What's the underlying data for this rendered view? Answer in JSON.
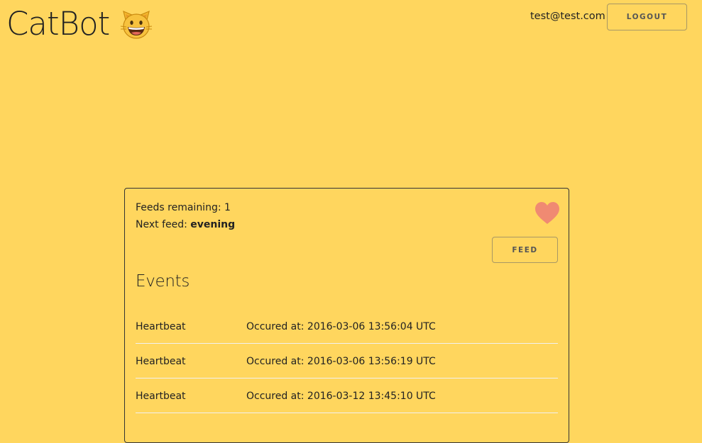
{
  "header": {
    "app_title": "CatBot",
    "logo_icon": "grinning-cat-face-icon",
    "user_email": "test@test.com",
    "logout_label": "LOGOUT"
  },
  "status": {
    "feeds_label": "Feeds remaining:",
    "feeds_remaining": "1",
    "next_feed_label": "Next feed:",
    "next_feed_value": "evening",
    "heart_icon": "heart-icon",
    "heart_color": "#F08A72"
  },
  "actions": {
    "feed_label": "FEED"
  },
  "events": {
    "title": "Events",
    "rows": [
      {
        "type": "Heartbeat",
        "time": "Occured at: 2016-03-06 13:56:04 UTC"
      },
      {
        "type": "Heartbeat",
        "time": "Occured at: 2016-03-06 13:56:19 UTC"
      },
      {
        "type": "Heartbeat",
        "time": "Occured at: 2016-03-12 13:45:10 UTC"
      }
    ]
  },
  "colors": {
    "background": "#FFD65E",
    "text": "#222222",
    "button_border": "#A89765"
  }
}
